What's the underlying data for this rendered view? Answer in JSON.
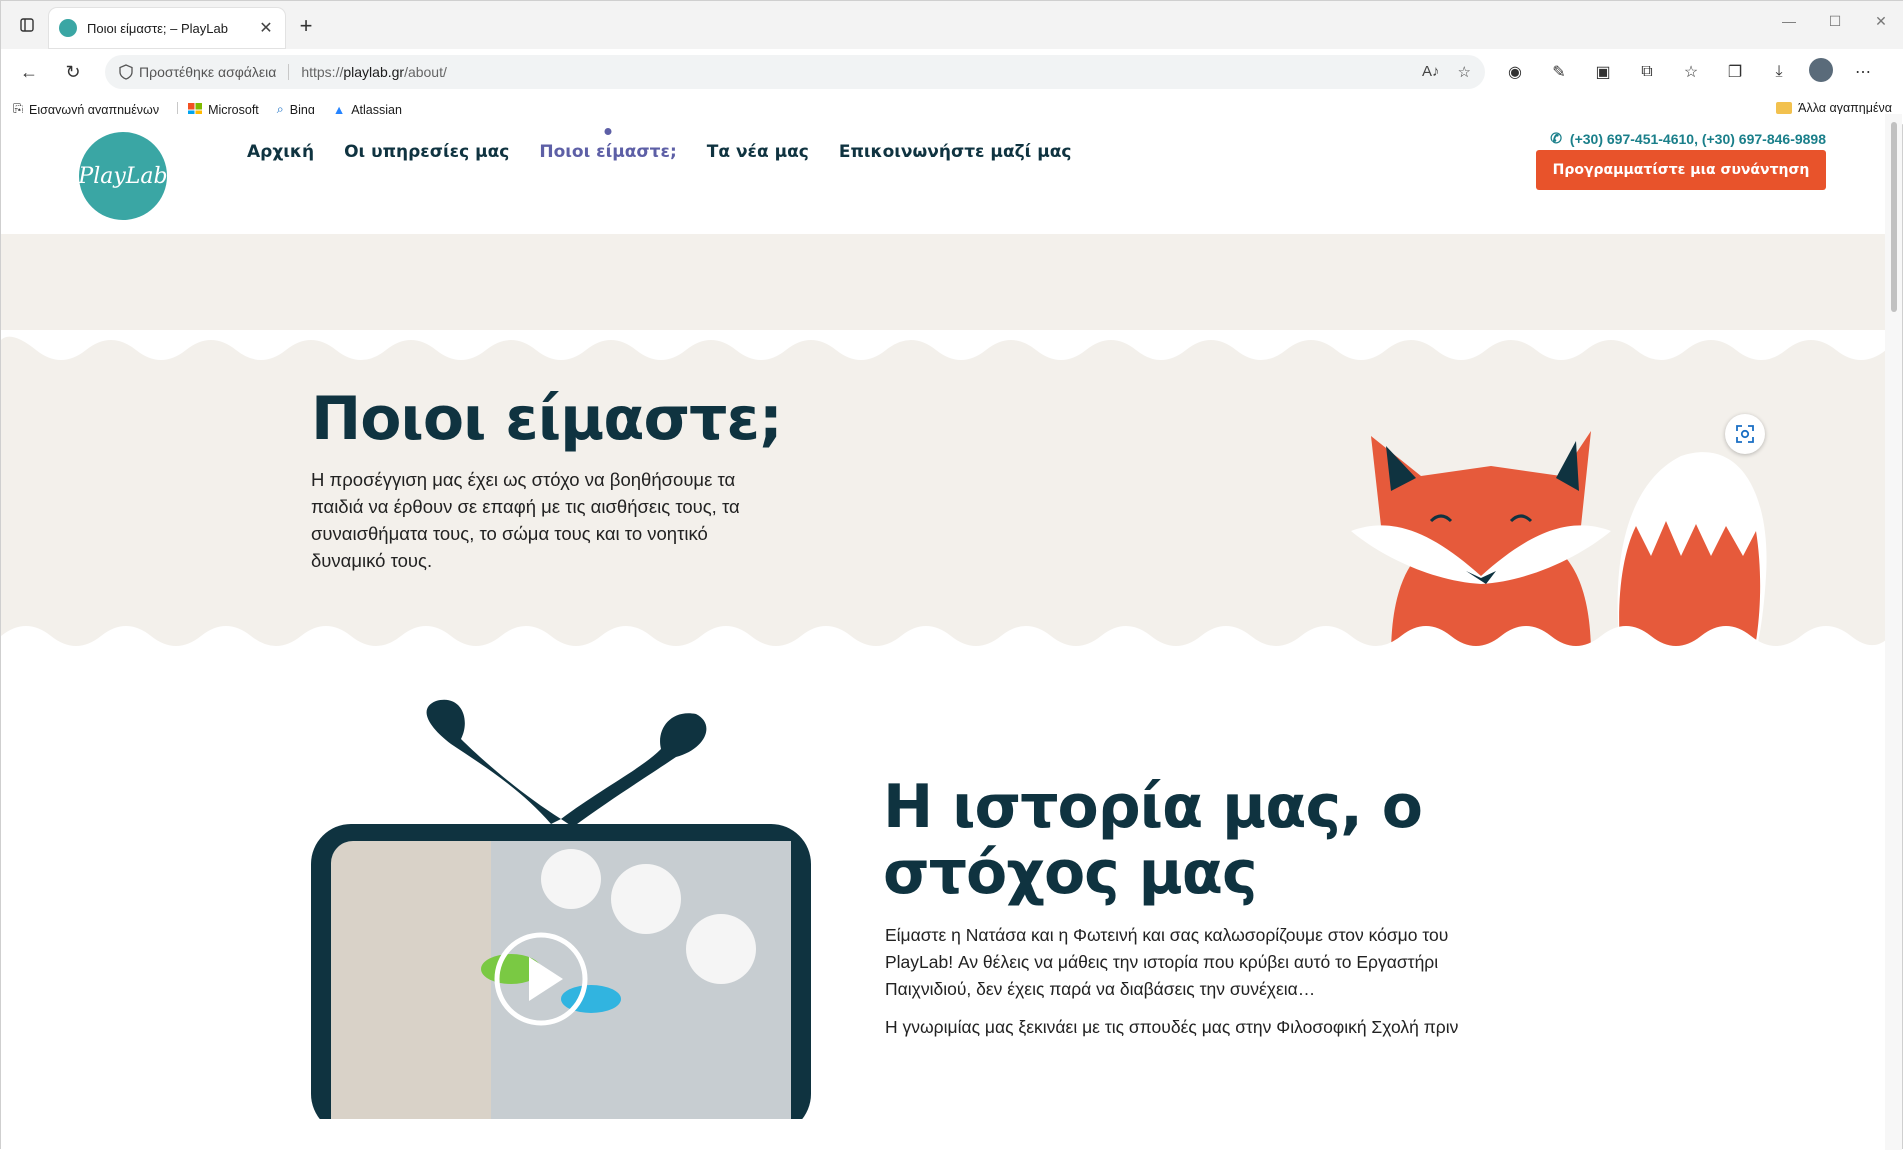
{
  "browser": {
    "tab_title": "Ποιοι είμαστε; – PlayLab",
    "security_label": "Προστέθηκε ασφάλεια",
    "url_prefix": "https://",
    "url_domain": "playlab.gr",
    "url_path": "/about/"
  },
  "bookmarks": {
    "import": "Εισαγωγή αγαπημένων",
    "items": [
      "Microsoft",
      "Bing",
      "Atlassian"
    ],
    "other": "Άλλα αγαπημένα"
  },
  "site": {
    "logo_text": "PlayLab",
    "nav": [
      "Αρχική",
      "Οι υπηρεσίες μας",
      "Ποιοι είμαστε;",
      "Τα νέα μας",
      "Επικοινωνήστε μαζί μας"
    ],
    "phone": "(+30) 697-451-4610, (+30) 697-846-9898",
    "cta": "Προγραμματίστε μια συνάντηση"
  },
  "hero": {
    "title": "Ποιοι είμαστε;",
    "text": "Η προσέγγιση μας έχει ως στόχο να βοηθήσουμε τα παιδιά να έρθουν σε επαφή με τις αισθήσεις τους, τα συναισθήματα τους, το σώμα τους και το νοητικό δυναμικό τους."
  },
  "story": {
    "title": "Η ιστορία μας, ο στόχος μας",
    "p1": "Είμαστε η Νατάσα και η Φωτεινή και σας καλωσορίζουμε στον κόσμο του PlayLab! Αν θέλεις να μάθεις την ιστορία που κρύβει αυτό το Εργαστήρι Παιχνιδιού, δεν έχεις παρά να διαβάσεις την συνέχεια…",
    "p2": "Η γνωριμίας μας ξεκινάει με τις σπουδές μας στην Φιλοσοφική Σχολή πριν"
  },
  "colors": {
    "brand_teal": "#3aa6a4",
    "navy": "#0f3340",
    "cta_orange": "#e8532b",
    "active_nav": "#5d5fa6",
    "hero_bg": "#f3f0eb"
  }
}
